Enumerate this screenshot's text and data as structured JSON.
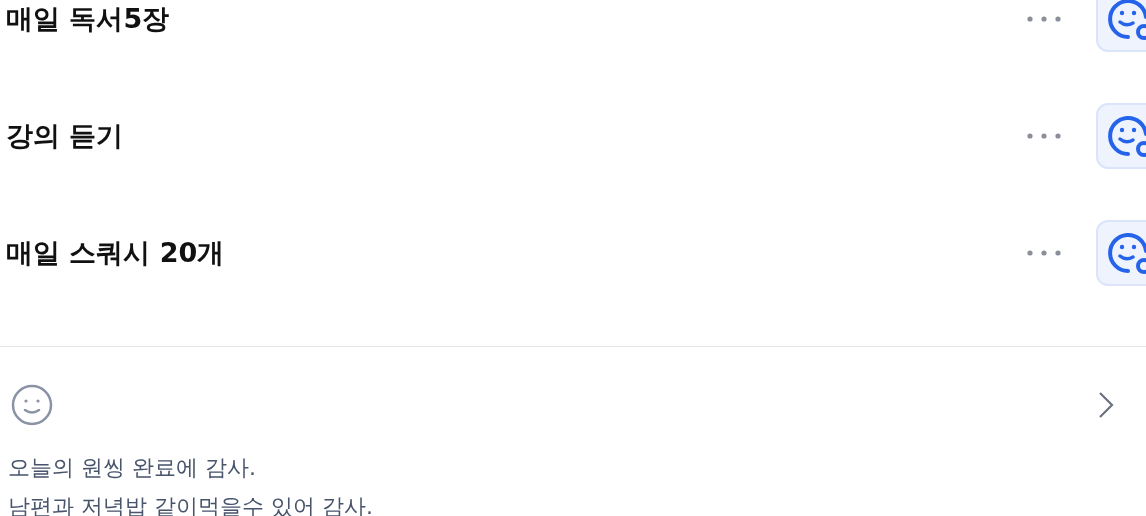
{
  "habits": [
    {
      "title": "매일 독서5장"
    },
    {
      "title": "강의 듣기"
    },
    {
      "title": "매일 스쿼시 20개"
    }
  ],
  "journal": {
    "lines": [
      "오늘의 원씽 완료에 감사.",
      "남편과 저녁밥 같이먹을수 있어 감사."
    ]
  }
}
